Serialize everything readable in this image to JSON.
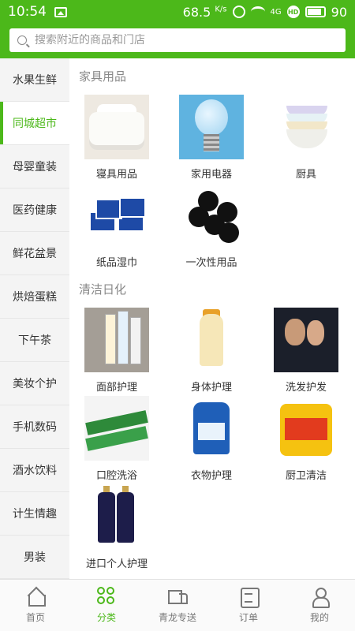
{
  "status_bar": {
    "time": "10:54",
    "speed": "68.5",
    "speed_unit": "K/s",
    "network": "4G",
    "hd": "HD",
    "battery": "90"
  },
  "search": {
    "placeholder": "搜索附近的商品和门店"
  },
  "sidebar": {
    "items": [
      {
        "label": "水果生鲜"
      },
      {
        "label": "同城超市"
      },
      {
        "label": "母婴童装"
      },
      {
        "label": "医药健康"
      },
      {
        "label": "鲜花盆景"
      },
      {
        "label": "烘焙蛋糕"
      },
      {
        "label": "下午茶"
      },
      {
        "label": "美妆个护"
      },
      {
        "label": "手机数码"
      },
      {
        "label": "酒水饮料"
      },
      {
        "label": "计生情趣"
      },
      {
        "label": "男装"
      }
    ],
    "active_index": 1
  },
  "sections": [
    {
      "title": "家具用品",
      "items": [
        {
          "label": "寝具用品",
          "icon": "bedding-image"
        },
        {
          "label": "家用电器",
          "icon": "light-bulb-image"
        },
        {
          "label": "厨具",
          "icon": "bowls-image"
        },
        {
          "label": "纸品湿巾",
          "icon": "tissue-box-image"
        },
        {
          "label": "一次性用品",
          "icon": "trash-bag-image"
        }
      ]
    },
    {
      "title": "清洁日化",
      "items": [
        {
          "label": "面部护理",
          "icon": "facial-cleanser-image"
        },
        {
          "label": "身体护理",
          "icon": "body-lotion-image"
        },
        {
          "label": "洗发护发",
          "icon": "shampoo-ad-image"
        },
        {
          "label": "口腔洗浴",
          "icon": "toothpaste-image"
        },
        {
          "label": "衣物护理",
          "icon": "laundry-detergent-image"
        },
        {
          "label": "厨卫清洁",
          "icon": "kitchen-cleaner-image"
        },
        {
          "label": "进口个人护理",
          "icon": "imported-shampoo-image"
        }
      ]
    }
  ],
  "tabbar": {
    "items": [
      {
        "label": "首页",
        "icon": "home-icon"
      },
      {
        "label": "分类",
        "icon": "category-icon"
      },
      {
        "label": "青龙专送",
        "icon": "truck-icon"
      },
      {
        "label": "订单",
        "icon": "order-icon"
      },
      {
        "label": "我的",
        "icon": "user-icon"
      }
    ],
    "active_index": 1
  },
  "colors": {
    "accent": "#4cb81a",
    "sidebar_bg": "#f4f4f4",
    "section_title": "#888888"
  }
}
